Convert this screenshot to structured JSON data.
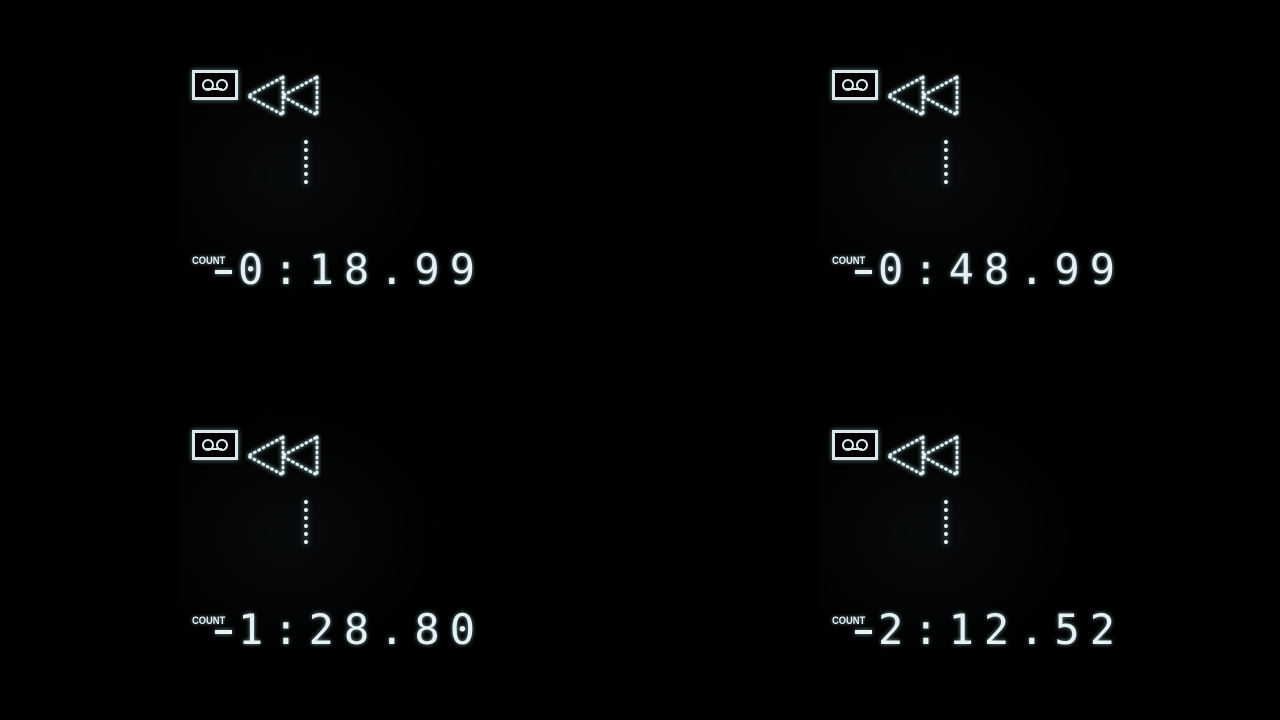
{
  "panels": [
    {
      "label": "COUNT",
      "sign": "-",
      "time": "0:18.99",
      "track": "1"
    },
    {
      "label": "COUNT",
      "sign": "-",
      "time": "0:48.99",
      "track": "1"
    },
    {
      "label": "COUNT",
      "sign": "-",
      "time": "1:28.80",
      "track": "1"
    },
    {
      "label": "COUNT",
      "sign": "-",
      "time": "2:12.52",
      "track": "1"
    }
  ],
  "icons": {
    "tape": "cassette-icon",
    "mode": "rewind-icon"
  },
  "colors": {
    "display": "#e6f1f3",
    "background": "#000000"
  }
}
